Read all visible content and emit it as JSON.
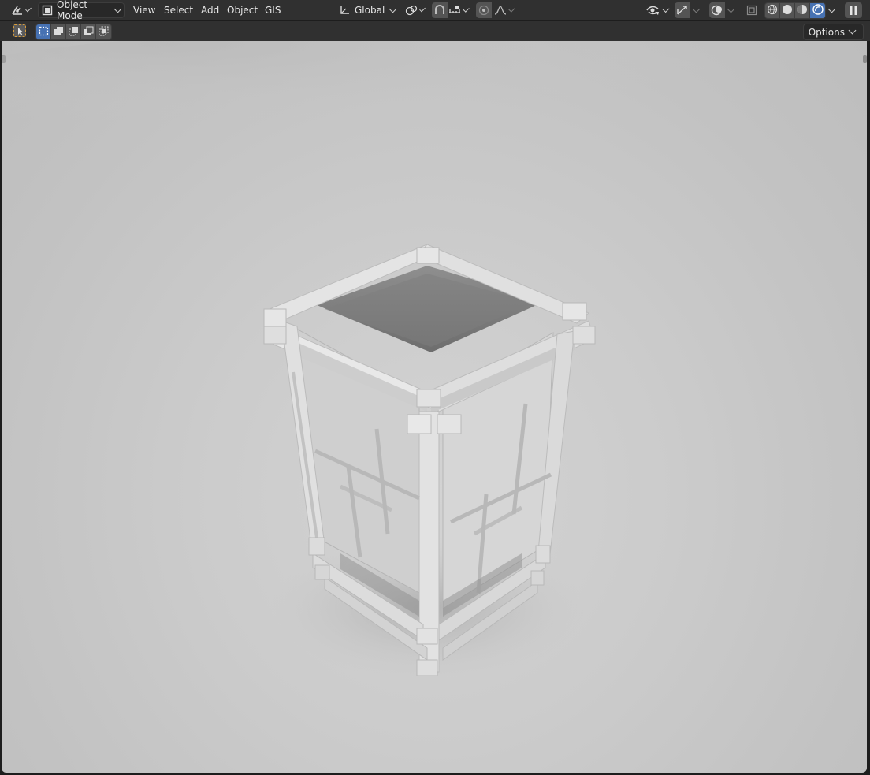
{
  "header": {
    "editor_type_icon": "viewport-editor-icon",
    "mode": {
      "icon": "object-mode-icon",
      "label": "Object Mode"
    },
    "menus": [
      "View",
      "Select",
      "Add",
      "Object",
      "GIS"
    ],
    "transform_orientation": {
      "icon": "orientation-icon",
      "label": "Global"
    },
    "pivot_icon": "pivot-point-icon",
    "snap_icon": "magnet-icon",
    "snap_target_icon": "snap-increment-icon",
    "proportional_icon": "proportional-edit-icon",
    "falloff_icon": "falloff-curve-icon",
    "visibility_icon": "eye-icon",
    "gizmo_icon": "gizmo-icon",
    "overlay_icon": "overlay-icon",
    "xray_icon": "xray-icon",
    "shading_icons": [
      "wireframe-shading-icon",
      "solid-shading-icon",
      "material-preview-icon",
      "rendered-shading-icon"
    ],
    "active_shading": "rendered",
    "pause_icon": "pause-render-icon"
  },
  "toolbar": {
    "select_tool_icon": "select-box-icon",
    "select_modes": [
      "new-selection-icon",
      "extend-selection-icon",
      "subtract-selection-icon",
      "invert-selection-icon",
      "intersect-selection-icon"
    ],
    "active_select_mode": 0,
    "options_label": "Options"
  },
  "viewport": {
    "scene": "rendered-lantern-model",
    "background_color": "#c8c8c8",
    "object_color": "#dadada"
  },
  "colors": {
    "header_bg": "#303030",
    "accent": "#4772b3",
    "button_bg": "#545454"
  }
}
